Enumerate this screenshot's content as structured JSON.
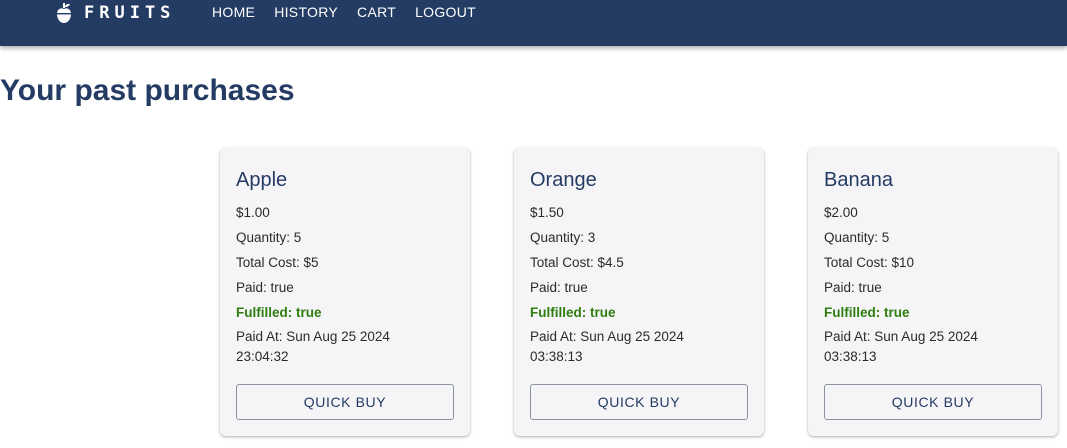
{
  "nav": {
    "brand": "FRUITS",
    "links": [
      "HOME",
      "HISTORY",
      "CART",
      "LOGOUT"
    ]
  },
  "page": {
    "title": "Your past purchases"
  },
  "purchases": [
    {
      "name": "Apple",
      "price": "$1.00",
      "quantity": "Quantity: 5",
      "total": "Total Cost: $5",
      "paid": "Paid: true",
      "fulfilled": "Fulfilled: true",
      "paid_at_line1": "Paid At: Sun Aug 25 2024",
      "paid_at_line2": "23:04:32",
      "button": "QUICK BUY"
    },
    {
      "name": "Orange",
      "price": "$1.50",
      "quantity": "Quantity: 3",
      "total": "Total Cost: $4.5",
      "paid": "Paid: true",
      "fulfilled": "Fulfilled: true",
      "paid_at_line1": "Paid At: Sun Aug 25 2024",
      "paid_at_line2": "03:38:13",
      "button": "QUICK BUY"
    },
    {
      "name": "Banana",
      "price": "$2.00",
      "quantity": "Quantity: 5",
      "total": "Total Cost: $10",
      "paid": "Paid: true",
      "fulfilled": "Fulfilled: true",
      "paid_at_line1": "Paid At: Sun Aug 25 2024",
      "paid_at_line2": "03:38:13",
      "button": "QUICK BUY"
    }
  ],
  "colors": {
    "navbar": "#243b63",
    "accent": "#243b63",
    "fulfilled": "#2e7d10",
    "card_bg": "#f5f5f7"
  },
  "icons": {
    "brand": "fruit-icon"
  }
}
